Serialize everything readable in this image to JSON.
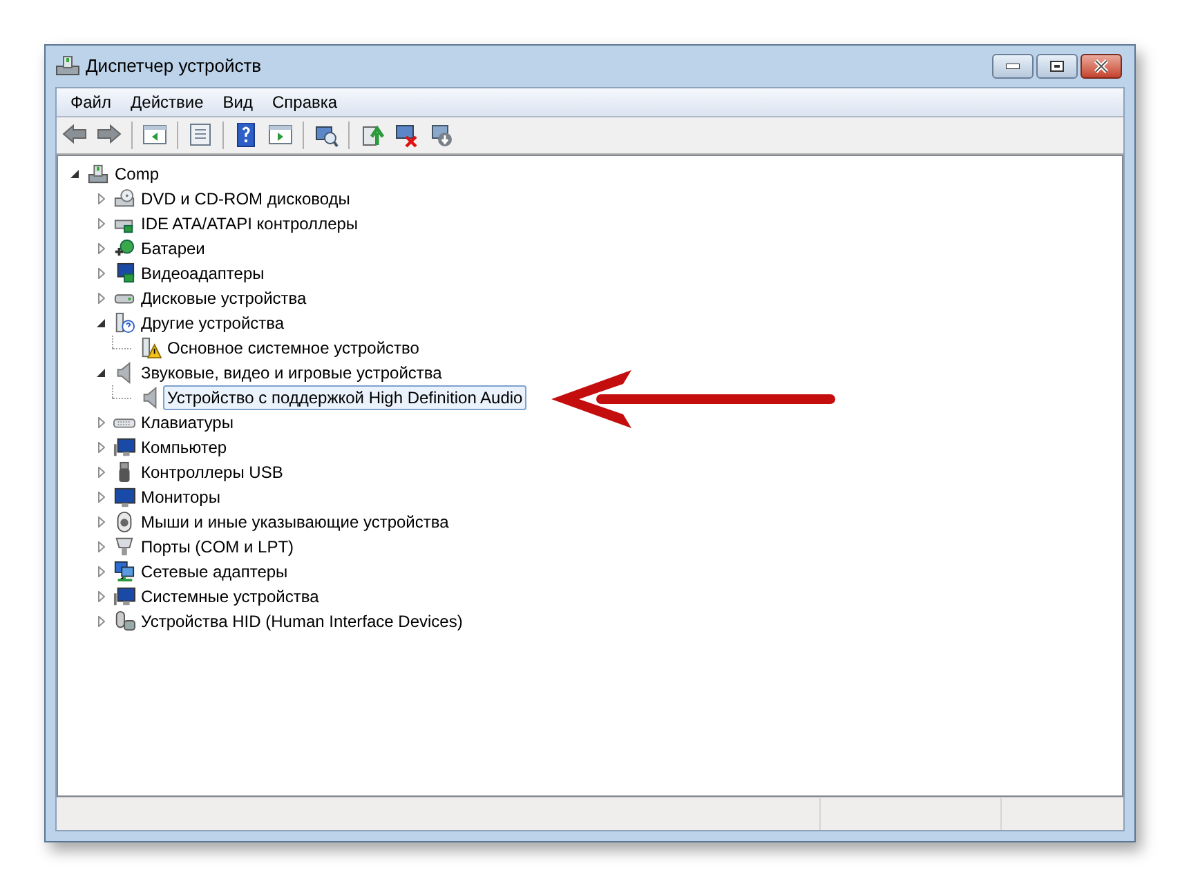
{
  "window": {
    "title": "Диспетчер устройств"
  },
  "menu": [
    "Файл",
    "Действие",
    "Вид",
    "Справка"
  ],
  "toolbar": [
    {
      "kind": "back"
    },
    {
      "kind": "forward"
    },
    {
      "kind": "sep"
    },
    {
      "kind": "tree"
    },
    {
      "kind": "sep"
    },
    {
      "kind": "props"
    },
    {
      "kind": "sep"
    },
    {
      "kind": "help"
    },
    {
      "kind": "pane"
    },
    {
      "kind": "sep"
    },
    {
      "kind": "scan"
    },
    {
      "kind": "sep"
    },
    {
      "kind": "update"
    },
    {
      "kind": "remove"
    },
    {
      "kind": "disable"
    }
  ],
  "tree": [
    {
      "label": "Comp",
      "expanded": true,
      "selected": false,
      "children": [
        {
          "label": "DVD и CD-ROM дисководы",
          "expanded": false,
          "selected": false
        },
        {
          "label": "IDE ATA/ATAPI контроллеры",
          "expanded": false,
          "selected": false
        },
        {
          "label": "Батареи",
          "expanded": false,
          "selected": false
        },
        {
          "label": "Видеоадаптеры",
          "expanded": false,
          "selected": false
        },
        {
          "label": "Дисковые устройства",
          "expanded": false,
          "selected": false
        },
        {
          "label": "Другие устройства",
          "expanded": true,
          "selected": false,
          "children": [
            {
              "label": "Основное системное устройство",
              "selected": false
            }
          ]
        },
        {
          "label": "Звуковые, видео и игровые устройства",
          "expanded": true,
          "selected": false,
          "children": [
            {
              "label": "Устройство с поддержкой High Definition Audio",
              "selected": true
            }
          ]
        },
        {
          "label": "Клавиатуры",
          "expanded": false,
          "selected": false
        },
        {
          "label": "Компьютер",
          "expanded": false,
          "selected": false
        },
        {
          "label": "Контроллеры USB",
          "expanded": false,
          "selected": false
        },
        {
          "label": "Мониторы",
          "expanded": false,
          "selected": false
        },
        {
          "label": "Мыши и иные указывающие устройства",
          "expanded": false,
          "selected": false
        },
        {
          "label": "Порты (COM и LPT)",
          "expanded": false,
          "selected": false
        },
        {
          "label": "Сетевые адаптеры",
          "expanded": false,
          "selected": false
        },
        {
          "label": "Системные устройства",
          "expanded": false,
          "selected": false
        },
        {
          "label": "Устройства HID (Human Interface Devices)",
          "expanded": false,
          "selected": false
        }
      ]
    }
  ]
}
